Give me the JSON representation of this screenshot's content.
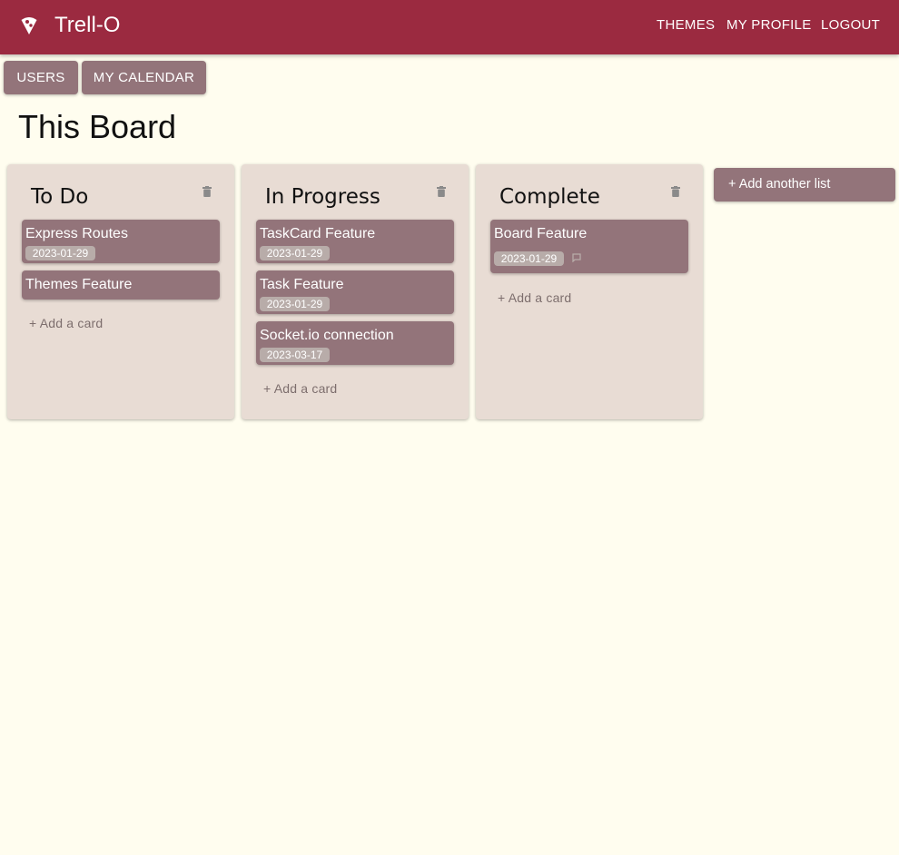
{
  "app": {
    "title": "Trell-O",
    "bar_color": "#9b2a40",
    "background": "#fffdef",
    "logo_icon": "pizza-icon"
  },
  "nav": {
    "themes": "THEMES",
    "my_profile": "MY PROFILE",
    "logout": "LOGOUT"
  },
  "toolbar": {
    "users": "USERS",
    "my_calendar": "MY CALENDAR"
  },
  "board": {
    "title": "This Board",
    "add_list_label": "+ Add another list",
    "add_card_label": "+ Add a card",
    "lists": [
      {
        "title": "To Do",
        "cards": [
          {
            "title": "Express Routes",
            "date": "2023-01-29"
          },
          {
            "title": "Themes Feature",
            "date": ""
          }
        ]
      },
      {
        "title": "In Progress",
        "cards": [
          {
            "title": "TaskCard Feature",
            "date": "2023-01-29"
          },
          {
            "title": "Task Feature",
            "date": "2023-01-29"
          },
          {
            "title": "Socket.io connection",
            "date": "2023-03-17"
          }
        ]
      },
      {
        "title": "Complete",
        "cards": [
          {
            "title": "Board Feature",
            "date": "2023-01-29",
            "has_comment": true
          }
        ]
      }
    ]
  }
}
